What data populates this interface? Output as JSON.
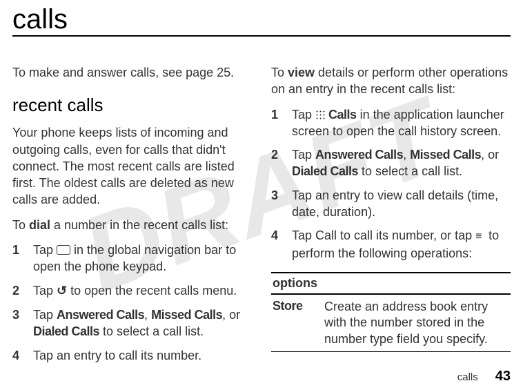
{
  "watermark": "DRAFT",
  "title": "calls",
  "left": {
    "intro": "To make and answer calls, see page 25.",
    "section_heading": "recent calls",
    "overview": "Your phone keeps lists of incoming and outgoing calls, even for calls that didn't connect. The most recent calls are listed first. The oldest calls are deleted as new calls are added.",
    "dial_intro_pre": "To ",
    "dial_intro_bold": "dial",
    "dial_intro_post": " a number in the recent calls list:",
    "steps": [
      {
        "num": "1",
        "pre": "Tap ",
        "icon": "box",
        "post": " in the global navigation bar to open the phone keypad."
      },
      {
        "num": "2",
        "pre": "Tap ",
        "icon": "phone",
        "post": " to open the recent calls menu."
      },
      {
        "num": "3",
        "pre": "Tap ",
        "b1": "Answered Calls",
        "c1": ", ",
        "b2": "Missed Calls",
        "c2": ", or ",
        "b3": "Dialed Calls",
        "post": " to select a call list."
      },
      {
        "num": "4",
        "text": "Tap an entry to call its number."
      }
    ]
  },
  "right": {
    "view_pre": "To ",
    "view_bold": "view",
    "view_post": " details or perform other operations on an entry in the recent calls list:",
    "steps": [
      {
        "num": "1",
        "pre": "Tap ",
        "icon": "grid",
        "b1": "Calls",
        "post": " in the application launcher screen to open the call history screen."
      },
      {
        "num": "2",
        "pre": "Tap ",
        "b1": "Answered Calls",
        "c1": ", ",
        "b2": "Missed Calls",
        "c2": ", or ",
        "b3": "Dialed Calls",
        "post": " to select a call list."
      },
      {
        "num": "3",
        "text": "Tap an entry to view call details (time, date, duration)."
      },
      {
        "num": "4",
        "pre": "Tap Call to call its number, or tap ",
        "icon": "list",
        "post": " to perform the following operations:"
      }
    ],
    "options": {
      "header": "options",
      "rows": [
        {
          "label": "Store",
          "desc": "Create an address book entry with the number stored in the number type field you specify."
        }
      ]
    }
  },
  "footer": {
    "label": "calls",
    "page": "43"
  }
}
